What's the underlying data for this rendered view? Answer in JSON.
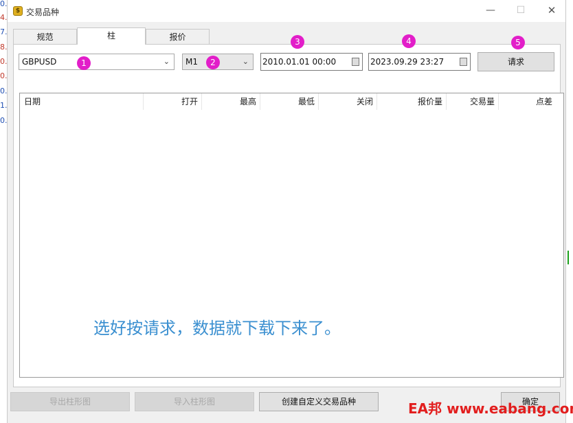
{
  "window": {
    "title": "交易品种",
    "app_icon_glyph": "$"
  },
  "window_controls": {
    "minimize": "—",
    "maximize": "☐",
    "close": "✕"
  },
  "tabs": [
    {
      "label": "规范"
    },
    {
      "label": "柱"
    },
    {
      "label": "报价"
    }
  ],
  "toolbar": {
    "symbol": "GBPUSD",
    "timeframe": "M1",
    "date_from": "2010.01.01 00:00",
    "date_to": "2023.09.29 23:27",
    "request_label": "请求"
  },
  "badges": [
    "1",
    "2",
    "3",
    "4",
    "5"
  ],
  "table": {
    "columns": [
      "日期",
      "打开",
      "最高",
      "最低",
      "关闭",
      "报价量",
      "交易量",
      "点差"
    ]
  },
  "annotation": "选好按请求，数据就下载下来了。",
  "footer": {
    "export_label": "导出柱形图",
    "import_label": "导入柱形图",
    "create_label": "创建自定义交易品种",
    "ok_label": "确定"
  },
  "watermark": "EA邦 www.eabang.com",
  "background_numbers": [
    "0.",
    "4.",
    "7.",
    "8.",
    "0.",
    "0.",
    "0.",
    "1.",
    "0."
  ],
  "colors": {
    "badge": "#e21ec9",
    "annotation": "#3a8fd0",
    "watermark": "#e21e1e"
  }
}
